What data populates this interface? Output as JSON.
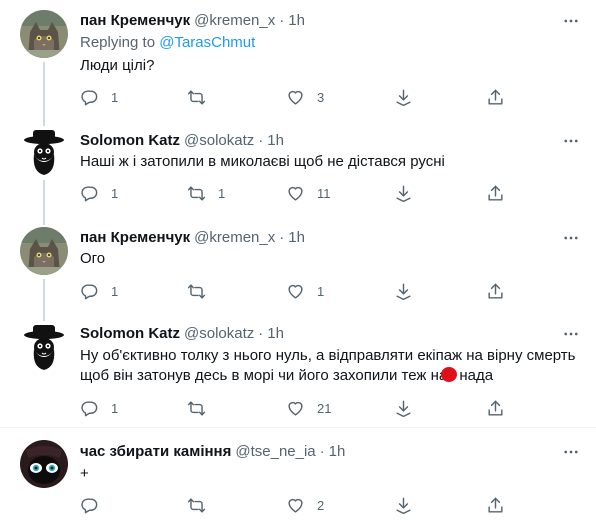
{
  "tweets": [
    {
      "name": "пан Кременчук",
      "handle": "@kremen_x",
      "time": "1h",
      "replying_label": "Replying to",
      "replying_to": "@TarasChmut",
      "text": "Люди цілі?",
      "replies": "1",
      "retweets": "",
      "likes": "3"
    },
    {
      "name": "Solomon Katz",
      "handle": "@solokatz",
      "time": "1h",
      "text": "Наші ж і затопили в миколаєві щоб не дістався русні",
      "replies": "1",
      "retweets": "1",
      "likes": "11"
    },
    {
      "name": "пан Кременчук",
      "handle": "@kremen_x",
      "time": "1h",
      "text": "Ого",
      "replies": "1",
      "retweets": "",
      "likes": "1"
    },
    {
      "name": "Solomon Katz",
      "handle": "@solokatz",
      "time": "1h",
      "text_line1": "Ну об'єктивно толку з нього нуль, а відправляти екіпаж на вірну смерть",
      "text_line2": "щоб він затонув десь в морі чи його захопили теж на",
      "text_line3": " нада",
      "replies": "1",
      "retweets": "",
      "likes": "21"
    },
    {
      "name": "час збирати каміння",
      "handle": "@tse_ne_ia",
      "time": "1h",
      "text": "+",
      "replies": "",
      "retweets": "",
      "likes": "2"
    }
  ],
  "common": {
    "dot": "·"
  },
  "colors": {
    "accent": "#1d9bf0",
    "secondary_text": "#536471",
    "redaction": "#e0101a"
  }
}
